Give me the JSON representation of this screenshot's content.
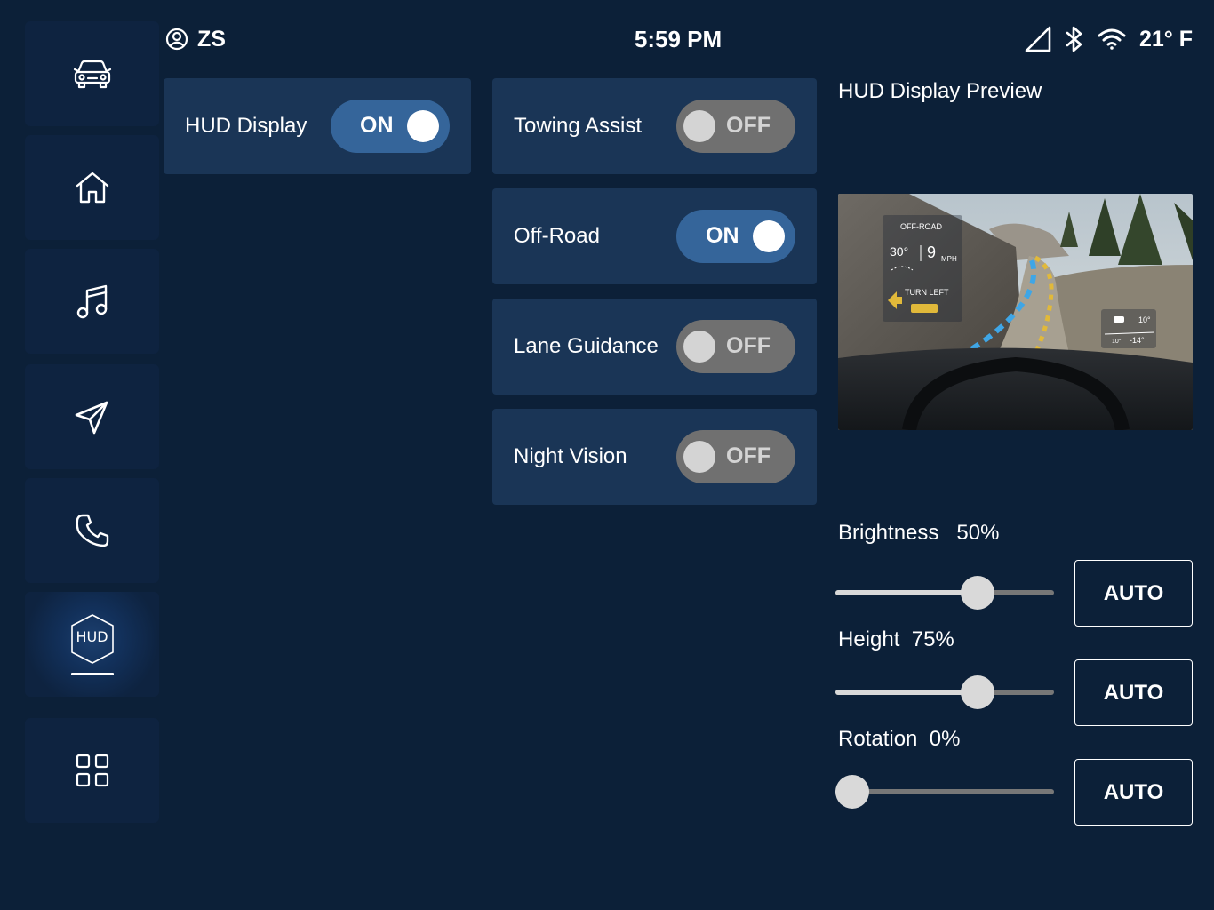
{
  "status": {
    "user": "ZS",
    "time": "5:59 PM",
    "temperature": "21° F"
  },
  "sidebar": {
    "items": [
      {
        "name": "vehicle",
        "icon": "car-icon"
      },
      {
        "name": "home",
        "icon": "home-icon"
      },
      {
        "name": "music",
        "icon": "music-note-icon"
      },
      {
        "name": "navigation",
        "icon": "navigation-arrow-icon"
      },
      {
        "name": "phone",
        "icon": "phone-icon"
      },
      {
        "name": "hud",
        "icon": "hud-hexagon-icon",
        "label": "HUD",
        "active": true
      },
      {
        "name": "apps",
        "icon": "grid-icon"
      }
    ]
  },
  "toggles": {
    "hud_display": {
      "label": "HUD Display",
      "state": "ON"
    },
    "towing_assist": {
      "label": "Towing Assist",
      "state": "OFF"
    },
    "off_road": {
      "label": "Off-Road",
      "state": "ON"
    },
    "lane_guidance": {
      "label": "Lane Guidance",
      "state": "OFF"
    },
    "night_vision": {
      "label": "Night Vision",
      "state": "OFF"
    }
  },
  "preview": {
    "title": "HUD Display Preview",
    "overlay": {
      "mode": "OFF-ROAD",
      "angle": "30°",
      "speed": "9",
      "speed_unit": "MPH",
      "turn": "TURN LEFT",
      "pitch": "10°",
      "roll_left": "10°",
      "roll_right": "-14°"
    }
  },
  "sliders": {
    "brightness": {
      "label": "Brightness",
      "value": "50%",
      "level": 0.65,
      "auto_label": "AUTO"
    },
    "height": {
      "label": "Height",
      "value": "75%",
      "level": 0.65,
      "auto_label": "AUTO"
    },
    "rotation": {
      "label": "Rotation",
      "value": "0%",
      "level": 0.0,
      "auto_label": "AUTO"
    }
  },
  "colors": {
    "background": "#0c2038",
    "card": "#1a3556",
    "toggle_on": "#35659a",
    "toggle_off": "#707070"
  }
}
